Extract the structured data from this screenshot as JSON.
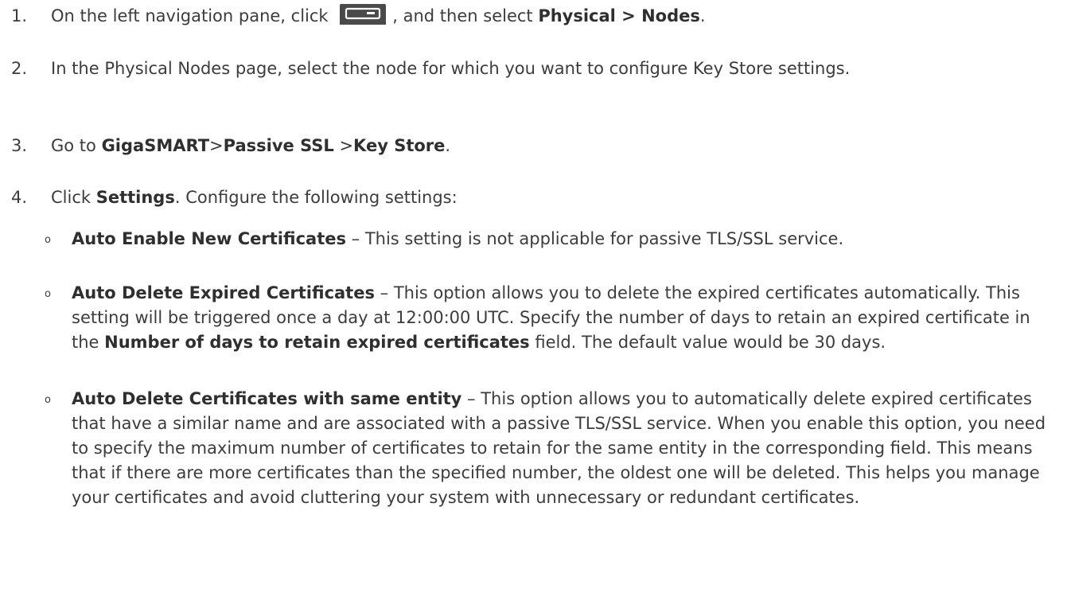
{
  "steps": [
    {
      "number": "1.",
      "pre": "On the left navigation pane, click ",
      "mid": ", and then select ",
      "bold": "Physical > Nodes",
      "post": ".",
      "icon": "device-panel-icon"
    },
    {
      "number": "2.",
      "text": "In the Physical Nodes page, select the node for which you want to configure Key Store settings."
    },
    {
      "number": "3.",
      "pre": "Go to ",
      "b1": "GigaSMART",
      "sep1": ">",
      "b2": "Passive SSL",
      "sep2": " >",
      "b3": "Key Store",
      "post": "."
    },
    {
      "number": "4.",
      "pre": "Click ",
      "bold": "Settings",
      "post": ". Configure the following settings:"
    }
  ],
  "settings": [
    {
      "bullet": "o",
      "title": "Auto Enable New Certificates",
      "text": " – This setting is not applicable for passive TLS/SSL service."
    },
    {
      "bullet": "o",
      "title": "Auto Delete Expired Certificates",
      "text1": " – This option allows you to delete the expired certificates automatically. This setting will be triggered once a day at 12:00:00 UTC. Specify the number of days to retain an expired certificate in the ",
      "field": "Number of days to retain expired certificates",
      "text2": " field. The default value would be 30 days."
    },
    {
      "bullet": "o",
      "title": "Auto Delete Certificates with same entity",
      "text": " – This option allows you to automatically delete expired certificates that have a similar name and are associated with a passive TLS/SSL service. When you enable this option, you need to specify the maximum number of certificates to retain for the same entity in the corresponding field. This means that if there are more certificates than the specified number, the oldest one will be deleted. This helps you manage your certificates and avoid cluttering your system with unnecessary or redundant certificates."
    }
  ]
}
